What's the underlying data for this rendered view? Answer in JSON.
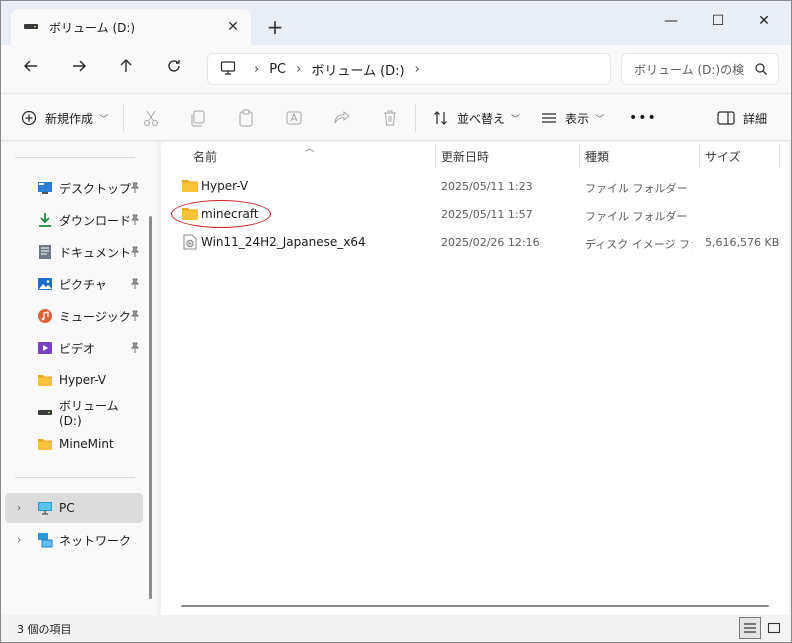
{
  "tab": {
    "title": "ボリューム (D:)",
    "close_label": "✕",
    "new_tab_label": "+"
  },
  "window_controls": {
    "minimize": "—",
    "maximize": "☐",
    "close": "✕"
  },
  "nav": {
    "breadcrumb": [
      "PC",
      "ボリューム (D:)"
    ],
    "separator": "›",
    "search_placeholder": "ボリューム (D:)の検"
  },
  "toolbar": {
    "new_label": "新規作成",
    "sort_label": "並べ替え",
    "view_label": "表示",
    "more_label": "•••",
    "details_label": "詳細"
  },
  "sidebar": {
    "quick_access": [
      {
        "label": "デスクトップ",
        "icon": "desktop-icon",
        "pinned": true
      },
      {
        "label": "ダウンロード",
        "icon": "download-icon",
        "pinned": true
      },
      {
        "label": "ドキュメント",
        "icon": "documents-icon",
        "pinned": true
      },
      {
        "label": "ピクチャ",
        "icon": "pictures-icon",
        "pinned": true
      },
      {
        "label": "ミュージック",
        "icon": "music-icon",
        "pinned": true
      },
      {
        "label": "ビデオ",
        "icon": "videos-icon",
        "pinned": true
      },
      {
        "label": "Hyper-V",
        "icon": "folder-icon",
        "pinned": false
      },
      {
        "label": "ボリューム (D:)",
        "icon": "drive-icon",
        "pinned": false
      },
      {
        "label": "MineMint",
        "icon": "folder-icon",
        "pinned": false
      }
    ],
    "tree": [
      {
        "label": "PC",
        "icon": "pc-icon",
        "selected": true
      },
      {
        "label": "ネットワーク",
        "icon": "network-icon",
        "selected": false
      }
    ]
  },
  "columns": {
    "name": "名前",
    "date": "更新日時",
    "type": "種類",
    "size": "サイズ"
  },
  "files": [
    {
      "name": "Hyper-V",
      "date": "2025/05/11 1:23",
      "type": "ファイル フォルダー",
      "size": "",
      "icon": "folder-icon"
    },
    {
      "name": "minecraft",
      "date": "2025/05/11 1:57",
      "type": "ファイル フォルダー",
      "size": "",
      "icon": "folder-icon",
      "annotated": true
    },
    {
      "name": "Win11_24H2_Japanese_x64",
      "date": "2025/02/26 12:16",
      "type": "ディスク イメージ ファ...",
      "size": "5,616,576 KB",
      "icon": "disc-image-icon"
    }
  ],
  "status": {
    "item_count": "3 個の項目"
  },
  "colors": {
    "folder": "#f7c23c",
    "accent": "#0067c0",
    "annotation": "#d02020"
  }
}
